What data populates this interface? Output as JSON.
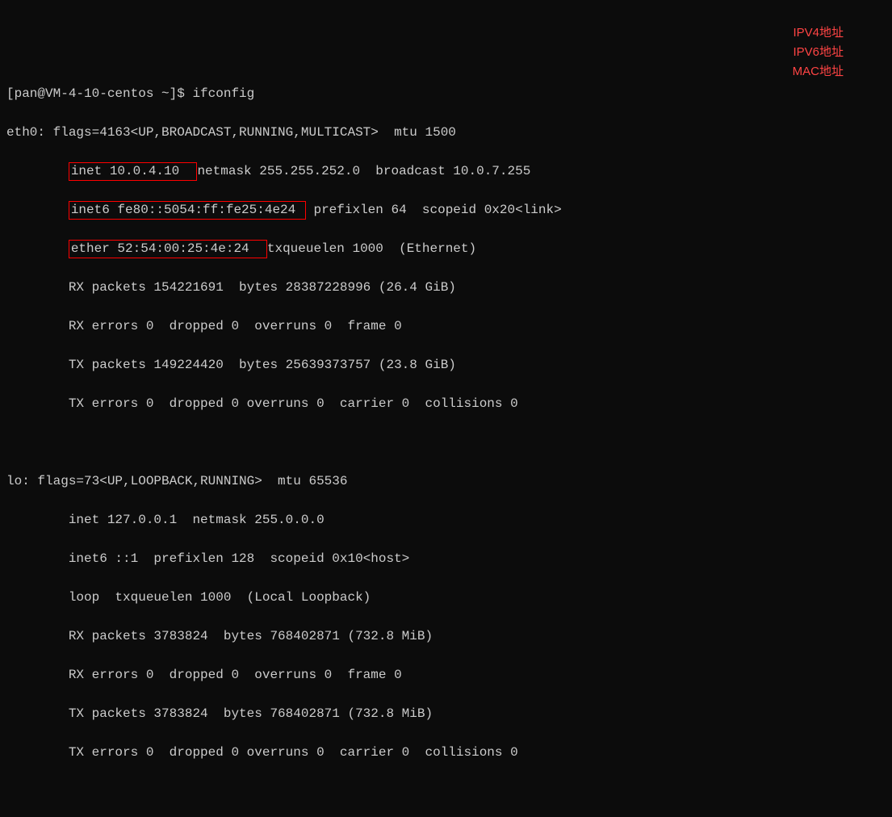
{
  "prompt": {
    "user_host": "[pan@VM-4-10-centos ~]$ ",
    "command": "ifconfig"
  },
  "eth0": {
    "header": "eth0: flags=4163<UP,BROADCAST,RUNNING,MULTICAST>  mtu 1500",
    "inet_prefix": "        ",
    "inet_box": "inet 10.0.4.10  ",
    "inet_rest": "netmask 255.255.252.0  broadcast 10.0.7.255",
    "inet6_prefix": "        ",
    "inet6_box": "inet6 fe80::5054:ff:fe25:4e24 ",
    "inet6_rest": " prefixlen 64  scopeid 0x20<link>",
    "ether_prefix": "        ",
    "ether_box": "ether 52:54:00:25:4e:24  ",
    "ether_rest": "txqueuelen 1000  (Ethernet)",
    "rx_packets": "        RX packets 154221691  bytes 28387228996 (26.4 GiB)",
    "rx_errors": "        RX errors 0  dropped 0  overruns 0  frame 0",
    "tx_packets": "        TX packets 149224420  bytes 25639373757 (23.8 GiB)",
    "tx_errors": "        TX errors 0  dropped 0 overruns 0  carrier 0  collisions 0"
  },
  "lo": {
    "header": "lo: flags=73<UP,LOOPBACK,RUNNING>  mtu 65536",
    "inet": "        inet 127.0.0.1  netmask 255.0.0.0",
    "inet6": "        inet6 ::1  prefixlen 128  scopeid 0x10<host>",
    "loop": "        loop  txqueuelen 1000  (Local Loopback)",
    "rx_packets": "        RX packets 3783824  bytes 768402871 (732.8 MiB)",
    "rx_errors": "        RX errors 0  dropped 0  overruns 0  frame 0",
    "tx_packets": "        TX packets 3783824  bytes 768402871 (732.8 MiB)",
    "tx_errors": "        TX errors 0  dropped 0 overruns 0  carrier 0  collisions 0"
  },
  "annotations": {
    "ipv4": "IPV4地址",
    "ipv6": "IPV6地址",
    "mac": "MAC地址"
  }
}
